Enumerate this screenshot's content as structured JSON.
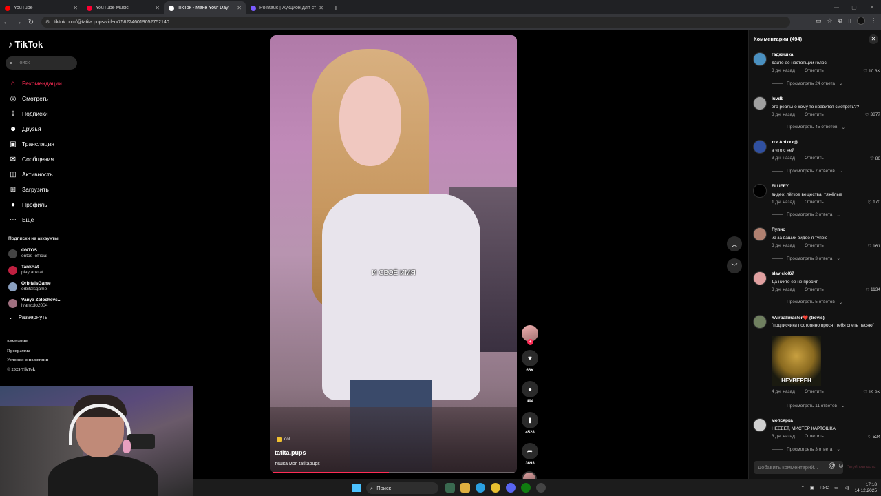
{
  "browser": {
    "tabs": [
      {
        "title": "YouTube",
        "favicon_color": "#ff0000",
        "active": false
      },
      {
        "title": "YouTube Music",
        "favicon_color": "#ff0033",
        "active": false
      },
      {
        "title": "TikTok - Make Your Day",
        "favicon_color": "#ffffff",
        "active": true
      },
      {
        "title": "Pointauc | Аукцион для стрим...",
        "favicon_color": "#7a5cff",
        "active": false
      }
    ],
    "url": "tiktok.com/@tatita.pups/video/7582246019052752140"
  },
  "sidebar": {
    "logo": "TikTok",
    "search_placeholder": "Поиск",
    "nav": [
      {
        "label": "Рекомендации",
        "icon": "home-icon",
        "active": true
      },
      {
        "label": "Смотреть",
        "icon": "compass-icon"
      },
      {
        "label": "Подписки",
        "icon": "following-icon"
      },
      {
        "label": "Друзья",
        "icon": "friends-icon"
      },
      {
        "label": "Трансляция",
        "icon": "live-icon"
      },
      {
        "label": "Сообщения",
        "icon": "messages-icon"
      },
      {
        "label": "Активность",
        "icon": "activity-icon",
        "badge": "50"
      },
      {
        "label": "Загрузить",
        "icon": "upload-icon"
      },
      {
        "label": "Профиль",
        "icon": "profile-icon"
      },
      {
        "label": "Еще",
        "icon": "more-icon"
      }
    ],
    "subs_title": "Подписки на аккаунты",
    "subs": [
      {
        "name": "ONTOS",
        "handle": "ontos_official",
        "color": "#444444"
      },
      {
        "name": "TankRat",
        "handle": "playtankrat",
        "color": "#c02040"
      },
      {
        "name": "OrbitalsGame",
        "handle": "orbitalsgame",
        "color": "#8aa0c0"
      },
      {
        "name": "Vanya Zolochevs...",
        "handle": "ivanzolo2004",
        "color": "#a07080"
      }
    ],
    "expand_label": "Развернуть",
    "footer": [
      "Компания",
      "Программа",
      "Условия и политики",
      "© 2025 TikTok"
    ]
  },
  "video": {
    "caption": "И СВОЁ ИМЯ",
    "tag": "doll",
    "author": "tatita.pups",
    "description": "ткшка моя tatitapups",
    "progress": 0.48
  },
  "actions": {
    "likes": "66K",
    "comments": "494",
    "saves": "4528",
    "shares": "3693"
  },
  "comments": {
    "header": "Комментарии (494)",
    "input_placeholder": "Добавить комментарий...",
    "post_label": "Опубликовать",
    "reply_label": "Ответить",
    "items": [
      {
        "user": "гаджишка",
        "text": "дайте её настоящий голос",
        "time": "3 дн. назад",
        "likes": "10.3K",
        "replies": "Просмотреть 24 ответа",
        "color": "#4a90c0"
      },
      {
        "user": "luvdb",
        "text": "это реально кому то нравится смотреть??",
        "time": "3 дн. назад",
        "likes": "3877",
        "replies": "Просмотреть 45 ответов",
        "color": "#a0a0a0"
      },
      {
        "user": "тгк Anixxx@",
        "text": "а что с ней",
        "time": "3 дн. назад",
        "likes": "86",
        "replies": "Просмотреть 7 ответов",
        "color": "#3050a0"
      },
      {
        "user": "FLUFFY",
        "text": "видео: лёгкое вещества: тяжёлые",
        "time": "1 дн. назад",
        "likes": "170",
        "replies": "Просмотреть 2 ответа",
        "color": "#000000"
      },
      {
        "user": "Пупис",
        "text": "из за ваших видео я тупею",
        "time": "3 дн. назад",
        "likes": "161",
        "replies": "Просмотреть 3 ответа",
        "color": "#b08070"
      },
      {
        "user": "slaviclol67",
        "text": "Да никто ее не просит",
        "time": "3 дн. назад",
        "likes": "1134",
        "replies": "Просмотреть 5 ответов",
        "color": "#e0a0a0"
      },
      {
        "user": "#Airballmaster❤️ (trevis)",
        "text": "\"подписчики постоянно просят тебя спеть песню\"",
        "time": "4 дн. назад",
        "likes": "19.9K",
        "replies": "Просмотреть 11 ответов",
        "color": "#708060",
        "image_text": "НЕУВЕРЕН"
      },
      {
        "user": "мопсярка",
        "text": "НЕЕЕЕТ, МИСТЕР КАРТОШКА",
        "time": "3 дн. назад",
        "likes": "524",
        "replies": "Просмотреть 3 ответа",
        "color": "#d0d0d0"
      }
    ]
  },
  "taskbar": {
    "search": "Поиск",
    "lang": "РУС",
    "time": "17:18",
    "date": "14.12.2025"
  }
}
